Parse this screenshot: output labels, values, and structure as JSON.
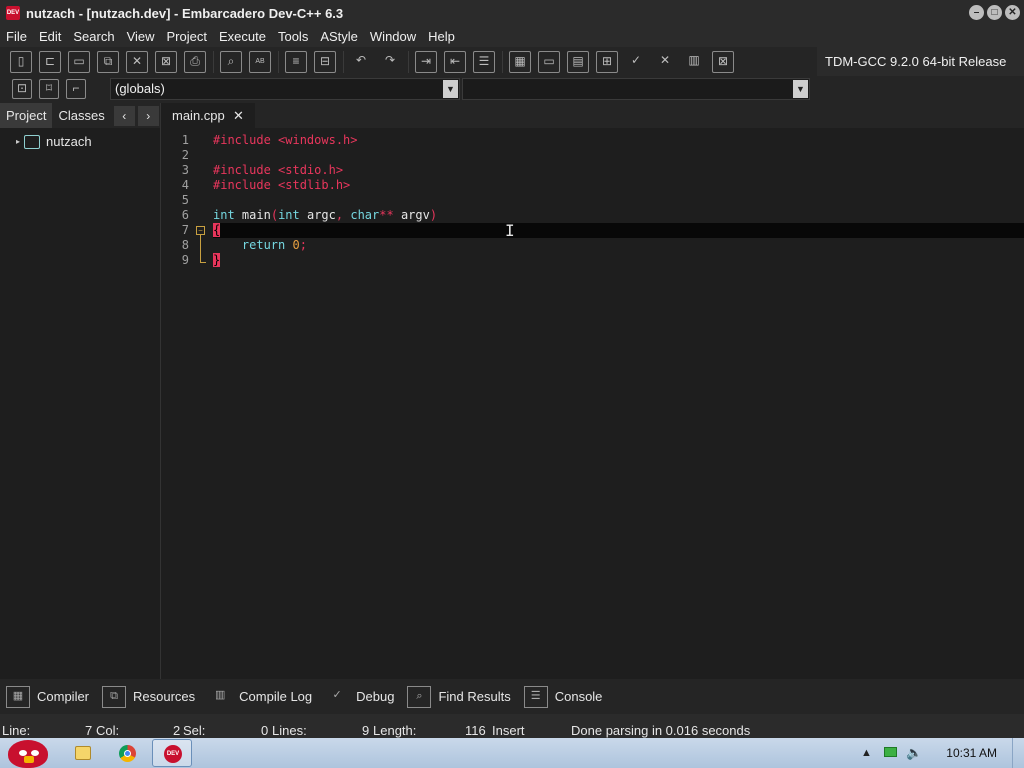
{
  "window": {
    "title": "nutzach - [nutzach.dev] - Embarcadero Dev-C++ 6.3",
    "app_icon_label": "DEV"
  },
  "menu": [
    "File",
    "Edit",
    "Search",
    "View",
    "Project",
    "Execute",
    "Tools",
    "AStyle",
    "Window",
    "Help"
  ],
  "toolbar": {
    "icons": [
      "new-file-icon",
      "open-icon",
      "save-icon",
      "save-all-icon",
      "close-icon",
      "close-all-icon",
      "print-icon",
      "find-icon",
      "replace-icon",
      "goto-icon",
      "goto-line-icon",
      "undo-icon",
      "redo-icon",
      "indent-icon",
      "unindent-icon",
      "comment-icon",
      "compile-icon",
      "run-icon",
      "compile-run-icon",
      "rebuild-icon",
      "syntax-check-icon",
      "stop-icon",
      "profile-icon",
      "delete-profile-icon"
    ],
    "compiler": "TDM-GCC 9.2.0 64-bit Release"
  },
  "class_combo": {
    "value": "(globals)"
  },
  "member_combo": {
    "value": ""
  },
  "left_panel": {
    "tabs": [
      "Project",
      "Classes"
    ],
    "project_name": "nutzach"
  },
  "editor": {
    "tab_label": "main.cpp",
    "lines": [
      "1",
      "2",
      "3",
      "4",
      "5",
      "6",
      "7",
      "8",
      "9"
    ]
  },
  "bottom_tabs": [
    "Compiler",
    "Resources",
    "Compile Log",
    "Debug",
    "Find Results",
    "Console"
  ],
  "status": {
    "line_label": "Line:",
    "line_value": "7",
    "col_label": "Col:",
    "col_value": "2",
    "sel_label": "Sel:",
    "sel_value": "0",
    "lines_label": "Lines:",
    "lines_value": "9",
    "length_label": "Length:",
    "length_value": "116",
    "mode": "Insert",
    "message": "Done parsing in 0.016 seconds"
  },
  "taskbar": {
    "clock": "10:31 AM"
  },
  "colors": {
    "preprocessor": "#e8365c",
    "keyword": "#75d7e0",
    "number": "#e8a040"
  }
}
